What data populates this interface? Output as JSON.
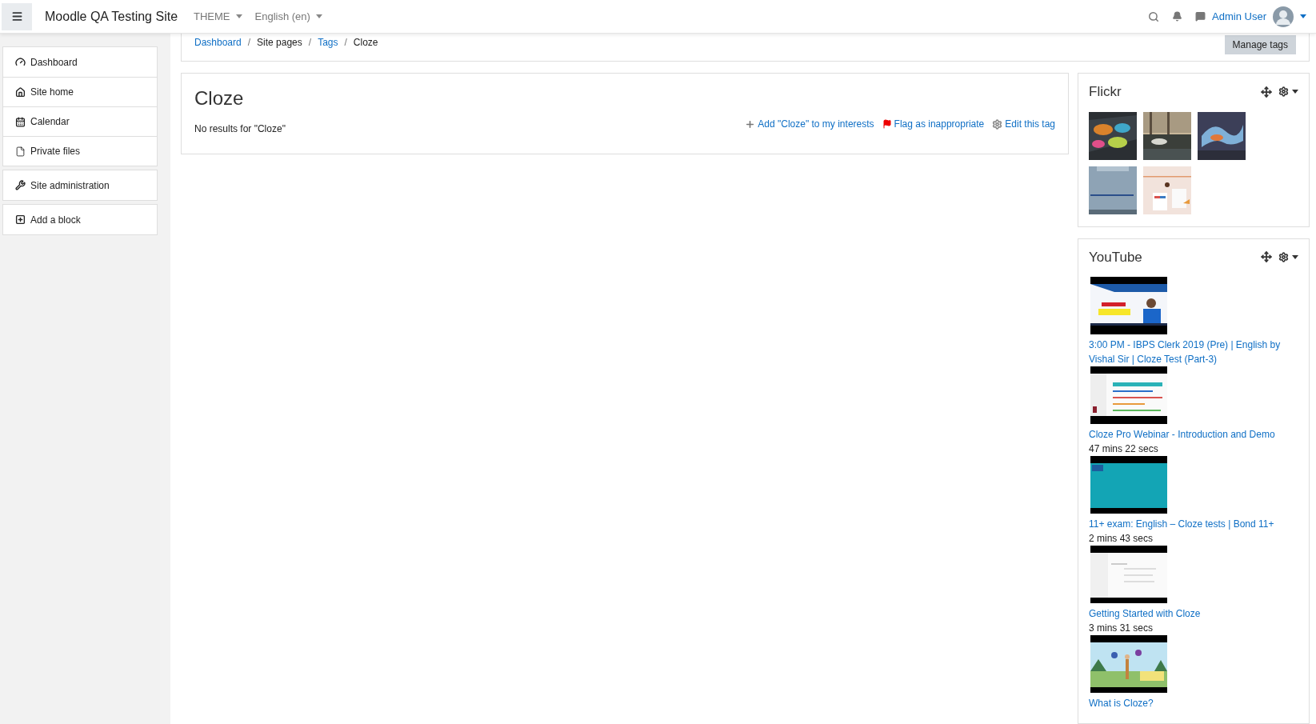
{
  "navbar": {
    "site_name": "Moodle QA Testing Site",
    "menus": [
      "THEME",
      "English (en)"
    ],
    "user_name": "Admin User"
  },
  "breadcrumb": [
    {
      "label": "Dashboard",
      "link": true
    },
    {
      "label": "Site pages",
      "link": false
    },
    {
      "label": "Tags",
      "link": true
    },
    {
      "label": "Cloze",
      "link": false
    }
  ],
  "breadcrumb_separator": "/",
  "manage_button": "Manage tags",
  "sidebar": {
    "groups": [
      [
        {
          "kind": "dashboard",
          "label": "Dashboard"
        },
        {
          "kind": "home",
          "label": "Site home"
        },
        {
          "kind": "calendar",
          "label": "Calendar"
        },
        {
          "kind": "file",
          "label": "Private files"
        }
      ],
      [
        {
          "kind": "wrench",
          "label": "Site administration"
        }
      ],
      [
        {
          "kind": "add",
          "label": "Add a block"
        }
      ]
    ]
  },
  "tag": {
    "title": "Cloze",
    "message": "No results for \"Cloze\"",
    "actions": [
      {
        "kind": "add",
        "label": "Add \"Cloze\" to my interests"
      },
      {
        "kind": "flag",
        "label": "Flag as inappropriate"
      },
      {
        "kind": "edit",
        "label": "Edit this tag"
      }
    ]
  },
  "flickr": {
    "title": "Flickr"
  },
  "youtube": {
    "title": "YouTube",
    "videos": [
      {
        "title": "3:00 PM - IBPS Clerk 2019 (Pre) | English by Vishal Sir | Cloze Test (Part-3)"
      },
      {
        "title": "Cloze Pro Webinar - Introduction and Demo",
        "duration": "47 mins 22 secs"
      },
      {
        "title": "11+ exam: English – Cloze tests | Bond 11+",
        "duration": "2 mins 43 secs"
      },
      {
        "title": "Getting Started with Cloze",
        "duration": "3 mins 31 secs"
      },
      {
        "title": "What is Cloze?"
      }
    ]
  }
}
